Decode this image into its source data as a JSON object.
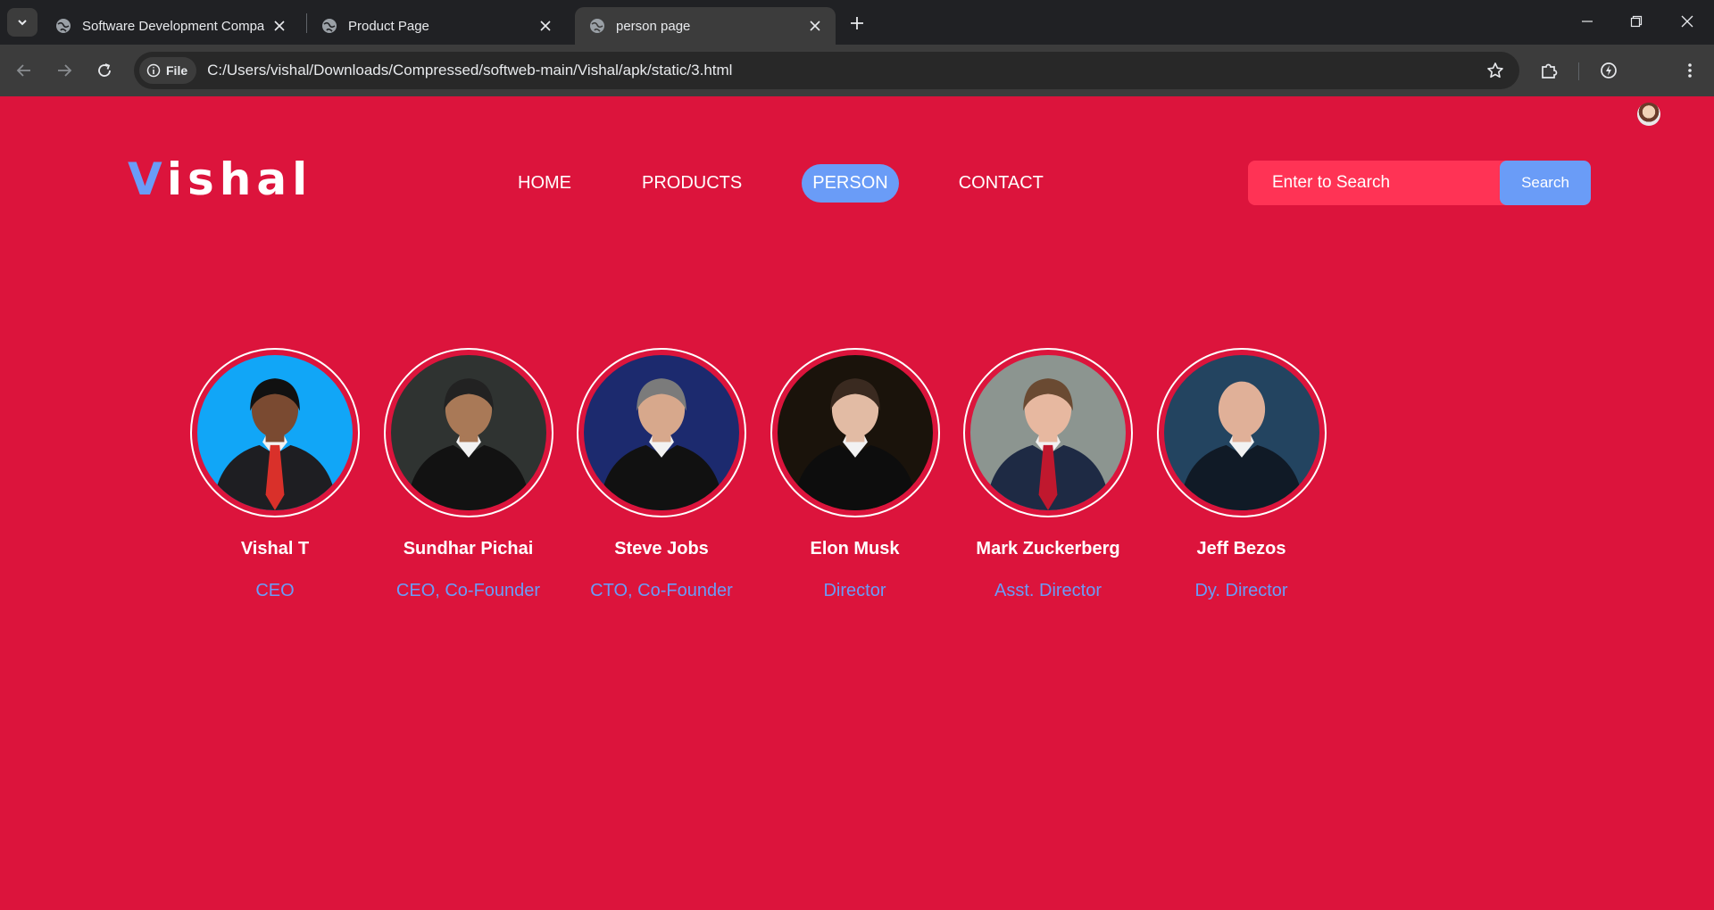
{
  "browser": {
    "tabs": [
      {
        "title": "Software Development Compar",
        "active": false
      },
      {
        "title": "Product Page",
        "active": false
      },
      {
        "title": "person page",
        "active": true
      }
    ],
    "url_chip": "File",
    "url": "C:/Users/vishal/Downloads/Compressed/softweb-main/Vishal/apk/static/3.html"
  },
  "header": {
    "logo_first": "V",
    "logo_rest": "ishal",
    "nav": [
      {
        "label": "HOME",
        "active": false
      },
      {
        "label": "PRODUCTS",
        "active": false
      },
      {
        "label": "PERSON",
        "active": true
      },
      {
        "label": "CONTACT",
        "active": false
      }
    ],
    "search": {
      "placeholder": "Enter to Search",
      "button_label": "Search"
    }
  },
  "people": [
    {
      "name": "Vishal T",
      "role": "CEO",
      "bg": "#11a6f7",
      "suit": "#1e1e22",
      "tie": "#d9302a",
      "skin": "#7a4a31",
      "hair": "#111111"
    },
    {
      "name": "Sundhar Pichai",
      "role": "CEO, Co-Founder",
      "bg": "#2f3331",
      "suit": "#121212",
      "tie": "",
      "skin": "#a97957",
      "hair": "#222222"
    },
    {
      "name": "Steve Jobs",
      "role": "CTO, Co-Founder",
      "bg": "#1c2a6e",
      "suit": "#111111",
      "tie": "",
      "skin": "#d7a88c",
      "hair": "#7b7b7b"
    },
    {
      "name": "Elon Musk",
      "role": "Director",
      "bg": "#1a130b",
      "suit": "#0d0d0d",
      "tie": "",
      "skin": "#e2bba4",
      "hair": "#3a2a20"
    },
    {
      "name": "Mark Zuckerberg",
      "role": "Asst. Director",
      "bg": "#8c9590",
      "suit": "#1e2a44",
      "tie": "#c0182e",
      "skin": "#e7b8a0",
      "hair": "#6a4a32"
    },
    {
      "name": "Jeff Bezos",
      "role": "Dy. Director",
      "bg": "#234460",
      "suit": "#101a26",
      "tie": "",
      "skin": "#e0b098",
      "hair": ""
    }
  ],
  "colors": {
    "page_bg": "#dc143c",
    "accent": "#6a9cf7",
    "search_bg": "#ff3355"
  }
}
